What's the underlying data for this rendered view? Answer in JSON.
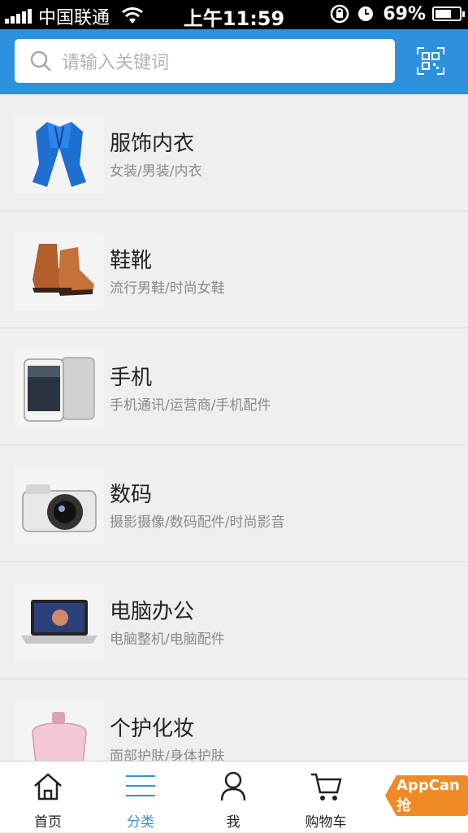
{
  "status_bar": {
    "carrier": "中国联通",
    "time": "上午11:59",
    "battery": "69%",
    "battery_level": 0.69
  },
  "search": {
    "placeholder": "请输入关键词",
    "scan_icon": "qr-scan-icon"
  },
  "categories": [
    {
      "title": "服饰内衣",
      "subtitle": "女装/男装/内衣",
      "icon": "clothing-image"
    },
    {
      "title": "鞋靴",
      "subtitle": "流行男鞋/时尚女鞋",
      "icon": "shoes-image"
    },
    {
      "title": "手机",
      "subtitle": "手机通讯/运营商/手机配件",
      "icon": "phone-image"
    },
    {
      "title": "数码",
      "subtitle": "摄影摄像/数码配件/时尚影音",
      "icon": "camera-image"
    },
    {
      "title": "电脑办公",
      "subtitle": "电脑整机/电脑配件",
      "icon": "laptop-image"
    },
    {
      "title": "个护化妆",
      "subtitle": "面部护肤/身体护肤",
      "icon": "perfume-image"
    }
  ],
  "tabbar": {
    "tabs": [
      {
        "label": "首页",
        "icon": "home-icon",
        "active": false
      },
      {
        "label": "分类",
        "icon": "list-icon",
        "active": true
      },
      {
        "label": "我",
        "icon": "person-icon",
        "active": false
      },
      {
        "label": "购物车",
        "icon": "cart-icon",
        "active": false
      }
    ],
    "badge_label": "AppCan抢"
  },
  "colors": {
    "accent": "#2d92de",
    "badge": "#f08a24"
  }
}
